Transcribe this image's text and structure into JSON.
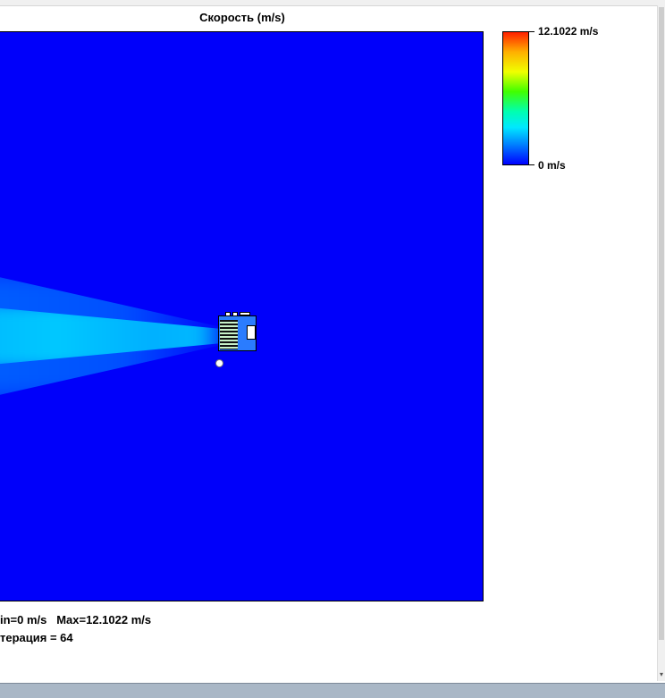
{
  "title": "Скорость (m/s)",
  "colorbar": {
    "max_label": "12.1022 m/s",
    "min_label": "0 m/s",
    "colors": [
      "#ff2000",
      "#ffb000",
      "#f0ff00",
      "#40ff00",
      "#00ffb0",
      "#00e8ff",
      "#0080ff",
      "#0000ff"
    ]
  },
  "stats": {
    "minmax": "in=0 m/s   Max=12.1022 m/s",
    "iteration": "терация = 64"
  },
  "field": {
    "background_color": "#0000fa",
    "jet_color": "#00c8ff"
  }
}
